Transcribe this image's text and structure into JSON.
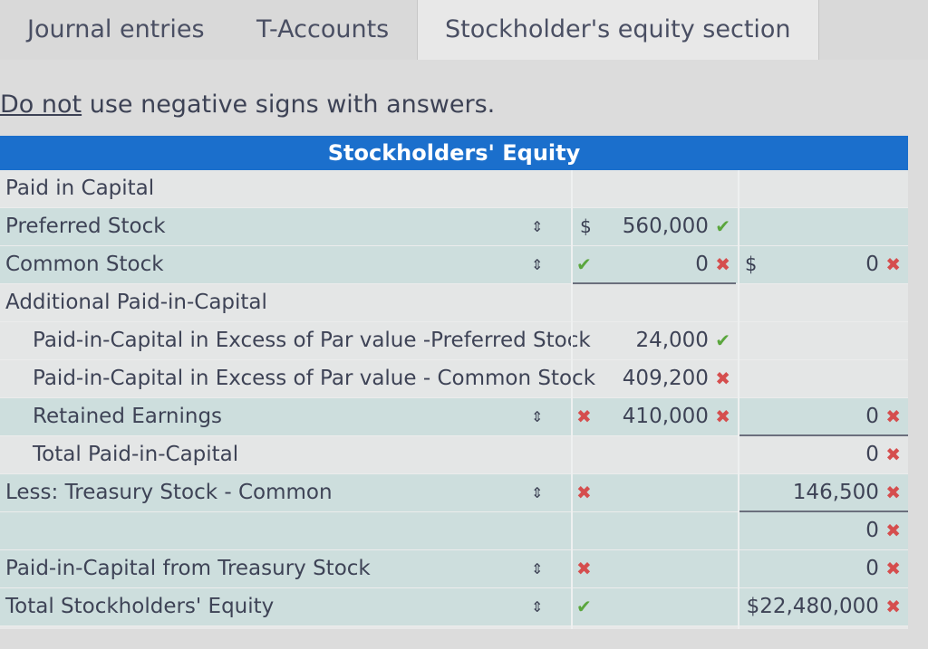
{
  "tabs": [
    {
      "label": "Journal entries"
    },
    {
      "label": "T-Accounts"
    },
    {
      "label": "Stockholder's equity section"
    }
  ],
  "instruction": {
    "underlined": "Do not",
    "rest": " use negative signs with answers."
  },
  "table": {
    "title": "Stockholders' Equity",
    "rows": [
      {
        "label": "Paid in Capital"
      },
      {
        "label": "Preferred Stock",
        "mark": "✔",
        "col1": "560,000",
        "col1_mark": "✔"
      },
      {
        "label": "Common Stock",
        "mark": "✔",
        "col1": "0",
        "col1_mark": "✖",
        "col2_dollar": "$",
        "col2": "0",
        "col2_mark": "✖"
      },
      {
        "label": "Additional Paid-in-Capital"
      },
      {
        "label": "Paid-in-Capital in Excess of Par value -Preferred Stock",
        "col1": "24,000",
        "col1_mark": "✔"
      },
      {
        "label": "Paid-in-Capital in Excess of Par value - Common Stock",
        "col1": "409,200",
        "col1_mark": "✖"
      },
      {
        "label": "Retained Earnings",
        "mark": "✖",
        "col1": "410,000",
        "col1_mark": "✖",
        "col2": "0",
        "col2_mark": "✖"
      },
      {
        "label": "Total Paid-in-Capital",
        "col2": "0",
        "col2_mark": "✖"
      },
      {
        "label": "Less: Treasury Stock - Common",
        "mark": "✖",
        "col2": "146,500",
        "col2_mark": "✖"
      },
      {
        "label": "",
        "col2": "0",
        "col2_mark": "✖"
      },
      {
        "label": "Paid-in-Capital from Treasury Stock",
        "mark": "✖",
        "col2": "0",
        "col2_mark": "✖"
      },
      {
        "label": "Total Stockholders' Equity",
        "mark": "✔",
        "col2": "$22,480,000",
        "col2_mark": "✖"
      }
    ],
    "first_col_dollar": "$",
    "dropdown_arrow": "⇕"
  },
  "colors": {
    "header": "#1b6fcc",
    "check": "#5aa63d",
    "cross": "#d54e4e",
    "shade": "#cddedd"
  }
}
